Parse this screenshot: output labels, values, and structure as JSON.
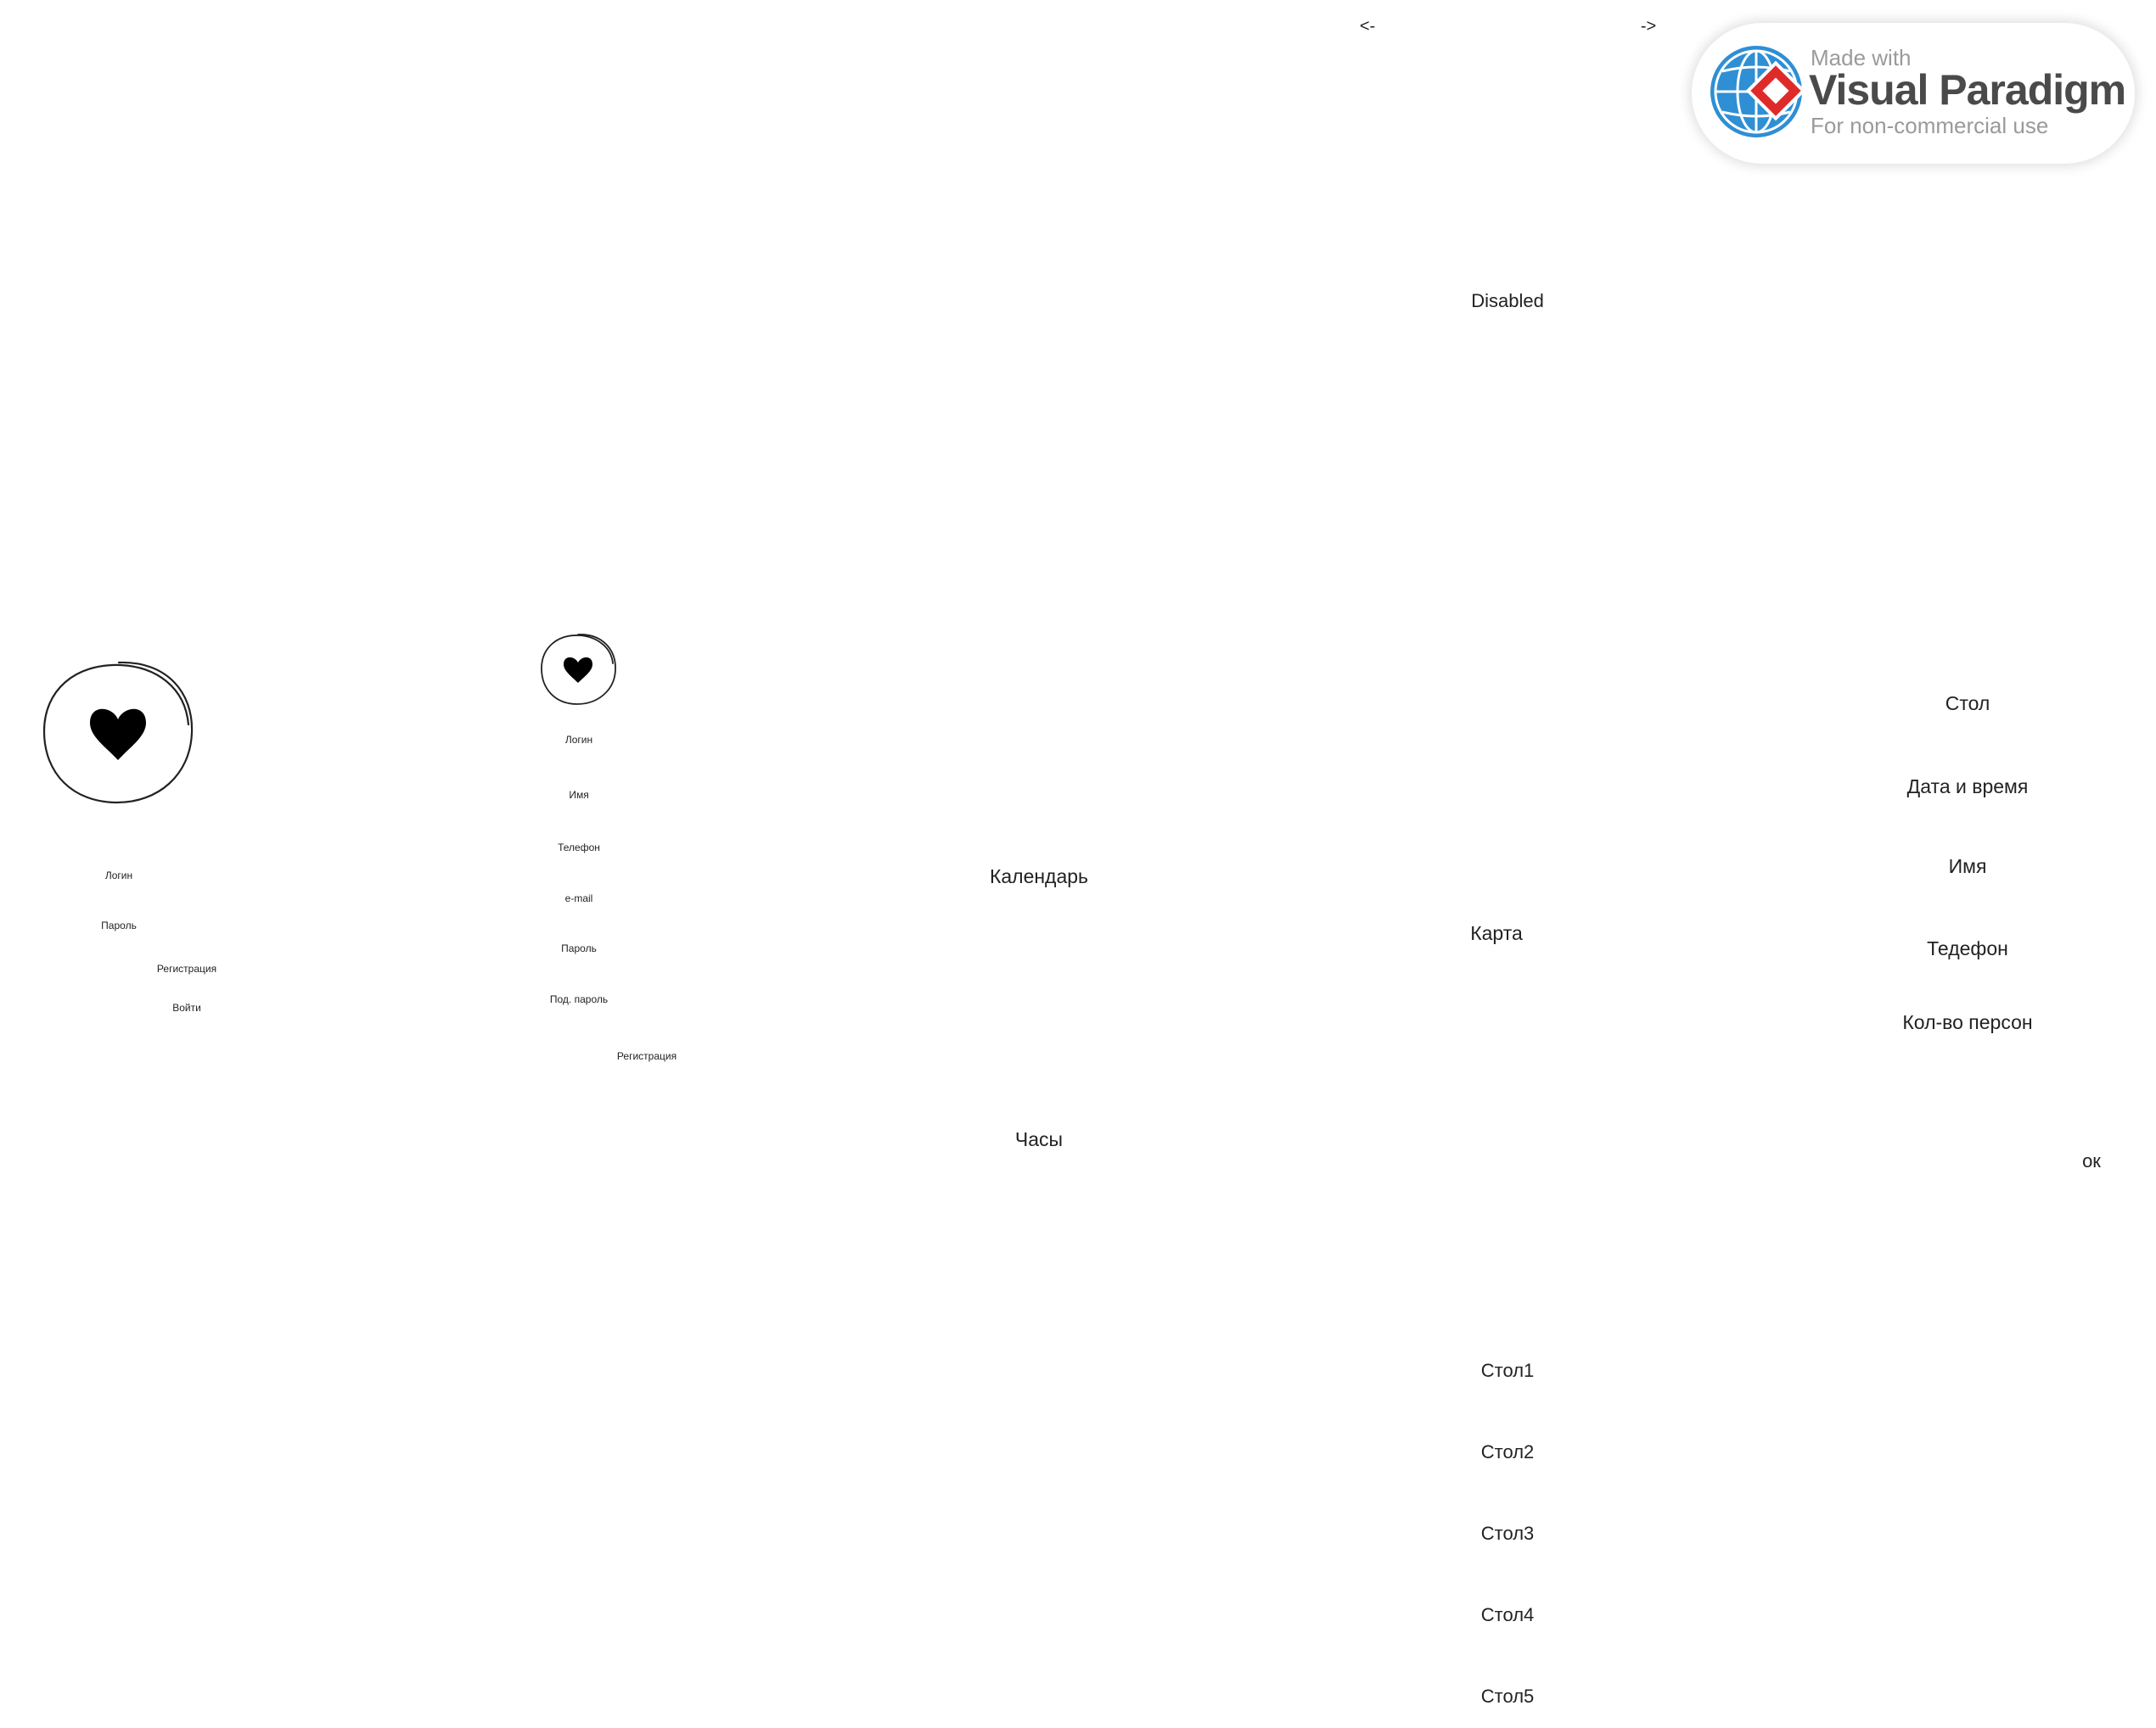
{
  "nav": {
    "prev": "<-",
    "next": "->"
  },
  "watermark": {
    "made_with": "Made with",
    "brand": "Visual Paradigm",
    "subtitle": "For non-commercial use"
  },
  "top_state": "Disabled",
  "login_screen": {
    "icon": "heart-icon",
    "login": "Логин",
    "password": "Пароль",
    "register": "Регистрация",
    "enter": "Войти"
  },
  "register_screen": {
    "icon": "heart-icon",
    "login": "Логин",
    "name": "Имя",
    "phone": "Телефон",
    "email": "e-mail",
    "password": "Пароль",
    "password_confirm": "Под. пароль",
    "register": "Регистрация"
  },
  "datetime_screen": {
    "calendar": "Календарь",
    "clock": "Часы"
  },
  "map_screen": {
    "map": "Карта",
    "tables": [
      "Стол1",
      "Стол2",
      "Стол3",
      "Стол4",
      "Стол5"
    ]
  },
  "booking_form": {
    "table": "Стол",
    "datetime": "Дата и время",
    "name": "Имя",
    "phone": "Тедефон",
    "persons": "Кол-во персон",
    "ok": "ок"
  },
  "colors": {
    "text": "#222222",
    "globe_blue": "#2e8fd4",
    "logo_red": "#e02a2a"
  }
}
